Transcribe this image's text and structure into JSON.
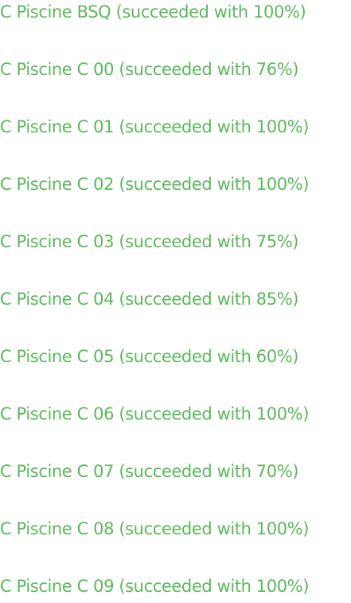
{
  "theme": {
    "success_color": "#5cb85c"
  },
  "projects": [
    {
      "label": "C Piscine BSQ (succeeded with 100%)",
      "status": "succeeded",
      "score": 100
    },
    {
      "label": "C Piscine C 00 (succeeded with 76%)",
      "status": "succeeded",
      "score": 76
    },
    {
      "label": "C Piscine C 01 (succeeded with 100%)",
      "status": "succeeded",
      "score": 100
    },
    {
      "label": "C Piscine C 02 (succeeded with 100%)",
      "status": "succeeded",
      "score": 100
    },
    {
      "label": "C Piscine C 03 (succeeded with 75%)",
      "status": "succeeded",
      "score": 75
    },
    {
      "label": "C Piscine C 04 (succeeded with 85%)",
      "status": "succeeded",
      "score": 85
    },
    {
      "label": "C Piscine C 05 (succeeded with 60%)",
      "status": "succeeded",
      "score": 60
    },
    {
      "label": "C Piscine C 06 (succeeded with 100%)",
      "status": "succeeded",
      "score": 100
    },
    {
      "label": "C Piscine C 07 (succeeded with 70%)",
      "status": "succeeded",
      "score": 70
    },
    {
      "label": "C Piscine C 08 (succeeded with 100%)",
      "status": "succeeded",
      "score": 100
    },
    {
      "label": "C Piscine C 09 (succeeded with 100%)",
      "status": "succeeded",
      "score": 100
    }
  ]
}
